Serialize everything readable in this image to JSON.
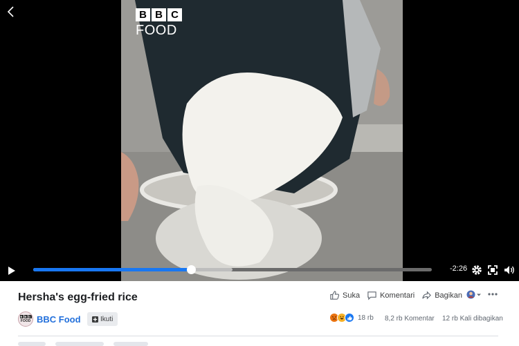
{
  "video": {
    "watermark_bbc": [
      "B",
      "B",
      "C"
    ],
    "watermark_food": "FOOD",
    "progress": 0.395,
    "buffered": 0.5,
    "time_remaining": "-2:26"
  },
  "post": {
    "title": "Hersha's egg-fried rice",
    "page_name": "BBC Food",
    "follow_label": "Ikuti",
    "actions": {
      "like": "Suka",
      "comment": "Komentari",
      "share": "Bagikan"
    },
    "reaction_count": "18 rb",
    "comments_count": "8,2 rb Komentar",
    "shares_count": "12 rb Kali dibagikan"
  },
  "colors": {
    "accent": "#1877f2",
    "page_name": "#216fdb"
  },
  "icons": [
    "back-icon",
    "play-icon",
    "settings-icon",
    "fullscreen-icon",
    "volume-icon",
    "like-icon",
    "comment-icon",
    "share-icon",
    "more-icon",
    "plus-icon",
    "angry-reaction-icon",
    "haha-reaction-icon",
    "like-reaction-icon"
  ]
}
